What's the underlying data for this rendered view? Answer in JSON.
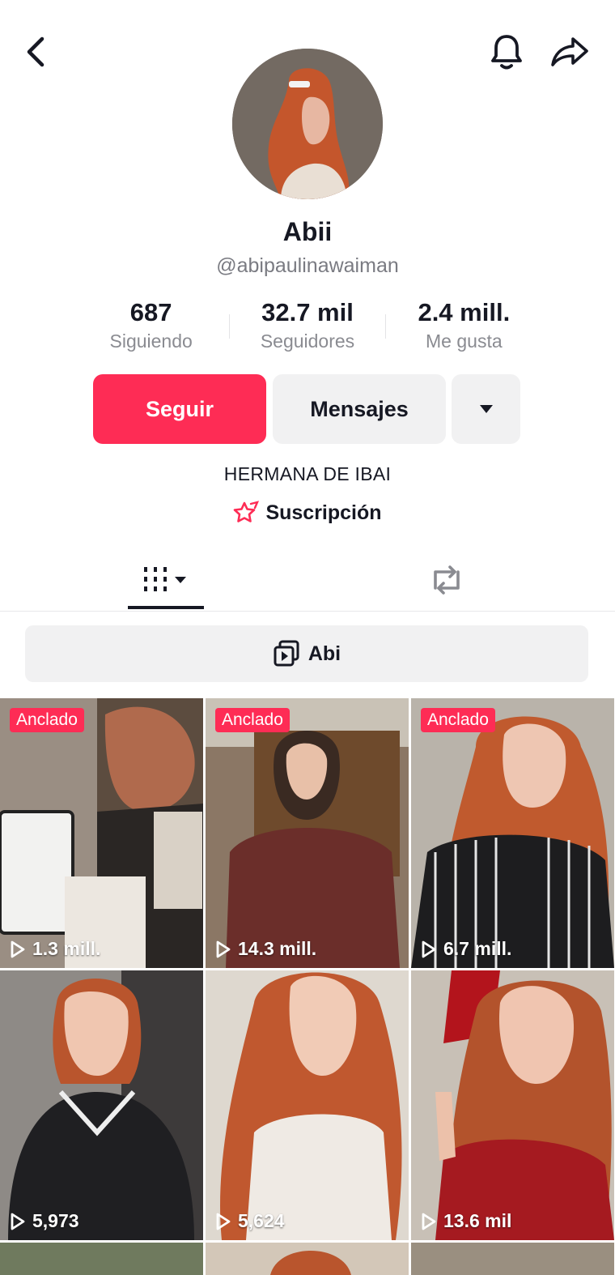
{
  "topbar": {
    "back_icon": "chevron-left-icon",
    "notification_icon": "bell-icon",
    "share_icon": "share-arrow-icon"
  },
  "profile": {
    "name": "Abii",
    "handle": "@abipaulinawaiman",
    "bio": "HERMANA DE IBAI",
    "subscription_label": "Suscripción"
  },
  "stats": [
    {
      "value": "687",
      "label": "Siguiendo"
    },
    {
      "value": "32.7 mil",
      "label": "Seguidores"
    },
    {
      "value": "2.4 mill.",
      "label": "Me gusta"
    }
  ],
  "buttons": {
    "follow": "Seguir",
    "message": "Mensajes"
  },
  "playlist": {
    "label": "Abi"
  },
  "videos": [
    {
      "pinned": "Anclado",
      "views": "1.3 mill."
    },
    {
      "pinned": "Anclado",
      "views": "14.3 mill."
    },
    {
      "pinned": "Anclado",
      "views": "6.7 mill."
    },
    {
      "pinned": "",
      "views": "5,973"
    },
    {
      "pinned": "",
      "views": "5,624"
    },
    {
      "pinned": "",
      "views": "13.6 mil"
    }
  ],
  "colors": {
    "accent": "#fe2c55",
    "text": "#161823",
    "muted": "#8a8b91",
    "surface": "#f1f1f2"
  }
}
